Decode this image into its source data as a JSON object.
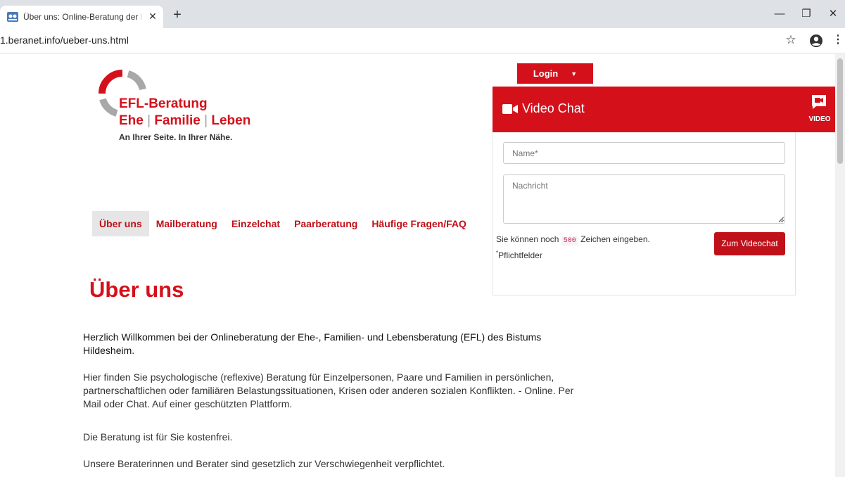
{
  "browser": {
    "tab_title": "Über uns: Online-Beratung der Ef",
    "tab_close": "✕",
    "new_tab": "+",
    "url": "1.beranet.info/ueber-uns.html",
    "min": "—",
    "max": "❐",
    "close": "✕"
  },
  "logo": {
    "title": "EFL-Beratung",
    "sub_1": "Ehe",
    "sub_sep": "|",
    "sub_2": "Familie",
    "sub_3": "Leben",
    "tagline": "An Ihrer Seite. In Ihrer Nähe."
  },
  "login": {
    "label": "Login",
    "caret": "▼"
  },
  "nav": {
    "items": [
      {
        "label": "Über uns",
        "active": true
      },
      {
        "label": "Mailberatung"
      },
      {
        "label": "Einzelchat"
      },
      {
        "label": "Paarberatung"
      },
      {
        "label": "Häufige Fragen/FAQ"
      }
    ]
  },
  "main": {
    "title": "Über uns",
    "lead": "Herzlich Willkommen bei der Onlineberatung der Ehe-, Familien- und Lebensberatung (EFL) des Bistums Hildesheim.",
    "paragraphs": [
      "Hier finden Sie psychologische (reflexive) Beratung für Einzelpersonen, Paare und Familien in persönlichen, partnerschaftlichen oder familiären Belastungssituationen, Krisen oder anderen sozialen Konflikten. - Online. Per Mail oder Chat. Auf einer geschützten Plattform.",
      "Die Beratung ist für Sie kostenfrei.",
      "Unsere Beraterinnen und Berater sind gesetzlich zur Verschwiegenheit verpflichtet."
    ]
  },
  "videochat": {
    "title": "Video Chat",
    "tab_label": "VIDEO",
    "name_placeholder": "Name*",
    "message_placeholder": "Nachricht",
    "info_prefix": "Sie können noch",
    "char_count": "500",
    "info_suffix": "Zeichen eingeben.",
    "required_mark": "*",
    "required_label": "Pflichtfelder",
    "submit_label": "Zum Videochat"
  },
  "colors": {
    "brand_red": "#d4111b",
    "nav_red": "#c01018",
    "logo_gray": "#a0a0a0"
  }
}
